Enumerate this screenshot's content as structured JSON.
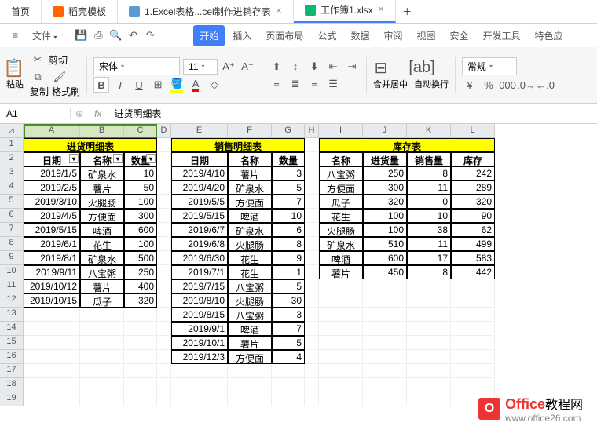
{
  "tabs": [
    {
      "label": "首页",
      "icon": "home"
    },
    {
      "label": "稻壳模板",
      "icon": "d"
    },
    {
      "label": "1.Excel表格...cel制作进销存表",
      "icon": "w",
      "closable": true
    },
    {
      "label": "工作簿1.xlsx",
      "icon": "s",
      "closable": true,
      "active": true
    }
  ],
  "menubar": {
    "file": "文件",
    "items": [
      "开始",
      "插入",
      "页面布局",
      "公式",
      "数据",
      "审阅",
      "视图",
      "安全",
      "开发工具",
      "特色应"
    ]
  },
  "toolbar": {
    "paste": "粘贴",
    "cut": "剪切",
    "copy": "复制",
    "format_painter": "格式刷",
    "font": "宋体",
    "size": "11",
    "merge": "合并居中",
    "wrap": "自动换行",
    "general": "常规"
  },
  "cellbar": {
    "ref": "A1",
    "formula": "进货明细表"
  },
  "cols": [
    "A",
    "B",
    "C",
    "D",
    "E",
    "F",
    "G",
    "H",
    "I",
    "J",
    "K",
    "L"
  ],
  "titles": {
    "t1": "进货明细表",
    "t2": "销售明细表",
    "t3": "库存表"
  },
  "headers": {
    "t1": [
      "日期",
      "名称",
      "数量"
    ],
    "t2": [
      "日期",
      "名称",
      "数量"
    ],
    "t3": [
      "名称",
      "进货量",
      "销售量",
      "库存"
    ]
  },
  "t1_rows": [
    [
      "2019/1/5",
      "矿泉水",
      "10"
    ],
    [
      "2019/2/5",
      "薯片",
      "50"
    ],
    [
      "2019/3/10",
      "火腿肠",
      "100"
    ],
    [
      "2019/4/5",
      "方便面",
      "300"
    ],
    [
      "2019/5/15",
      "啤酒",
      "600"
    ],
    [
      "2019/6/1",
      "花生",
      "100"
    ],
    [
      "2019/8/1",
      "矿泉水",
      "500"
    ],
    [
      "2019/9/11",
      "八宝粥",
      "250"
    ],
    [
      "2019/10/12",
      "薯片",
      "400"
    ],
    [
      "2019/10/15",
      "瓜子",
      "320"
    ]
  ],
  "t2_rows": [
    [
      "2019/4/10",
      "薯片",
      "3"
    ],
    [
      "2019/4/20",
      "矿泉水",
      "5"
    ],
    [
      "2019/5/5",
      "方便面",
      "7"
    ],
    [
      "2019/5/15",
      "啤酒",
      "10"
    ],
    [
      "2019/6/7",
      "矿泉水",
      "6"
    ],
    [
      "2019/6/8",
      "火腿肠",
      "8"
    ],
    [
      "2019/6/30",
      "花生",
      "9"
    ],
    [
      "2019/7/1",
      "花生",
      "1"
    ],
    [
      "2019/7/15",
      "八宝粥",
      "5"
    ],
    [
      "2019/8/10",
      "火腿肠",
      "30"
    ],
    [
      "2019/8/15",
      "八宝粥",
      "3"
    ],
    [
      "2019/9/1",
      "啤酒",
      "7"
    ],
    [
      "2019/10/1",
      "薯片",
      "5"
    ],
    [
      "2019/12/3",
      "方便面",
      "4"
    ]
  ],
  "t3_rows": [
    [
      "八宝粥",
      "250",
      "8",
      "242"
    ],
    [
      "方便面",
      "300",
      "11",
      "289"
    ],
    [
      "瓜子",
      "320",
      "0",
      "320"
    ],
    [
      "花生",
      "100",
      "10",
      "90"
    ],
    [
      "火腿肠",
      "100",
      "38",
      "62"
    ],
    [
      "矿泉水",
      "510",
      "11",
      "499"
    ],
    [
      "啤酒",
      "600",
      "17",
      "583"
    ],
    [
      "薯片",
      "450",
      "8",
      "442"
    ]
  ],
  "watermark": {
    "brand": "Office",
    "suffix": "教程网",
    "url": "www.office26.com"
  }
}
